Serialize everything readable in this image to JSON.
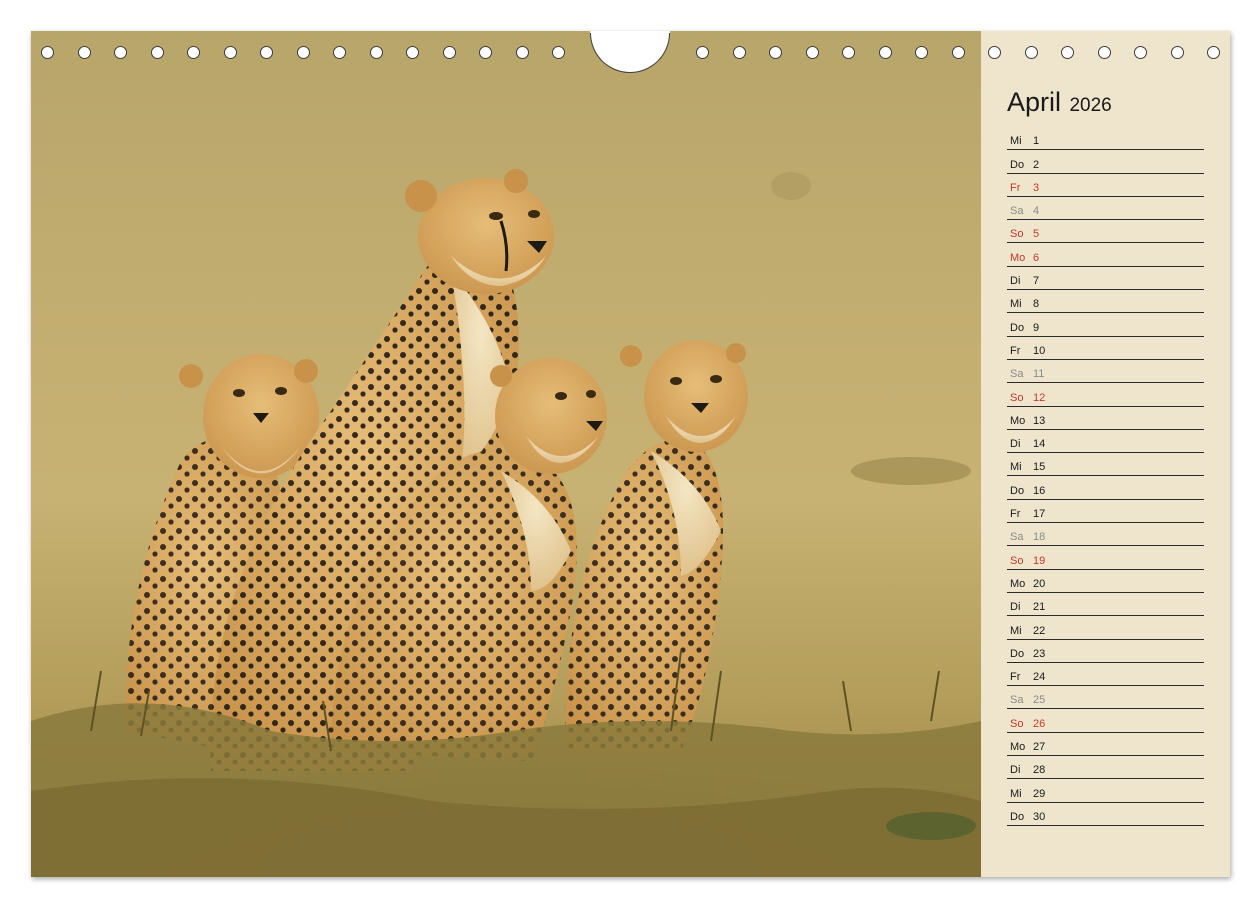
{
  "calendar": {
    "month": "April",
    "year": "2026",
    "days": [
      {
        "dw": "Mi",
        "dn": "1",
        "type": "normal"
      },
      {
        "dw": "Do",
        "dn": "2",
        "type": "normal"
      },
      {
        "dw": "Fr",
        "dn": "3",
        "type": "holiday"
      },
      {
        "dw": "Sa",
        "dn": "4",
        "type": "saturday"
      },
      {
        "dw": "So",
        "dn": "5",
        "type": "holiday"
      },
      {
        "dw": "Mo",
        "dn": "6",
        "type": "holiday"
      },
      {
        "dw": "Di",
        "dn": "7",
        "type": "normal"
      },
      {
        "dw": "Mi",
        "dn": "8",
        "type": "normal"
      },
      {
        "dw": "Do",
        "dn": "9",
        "type": "normal"
      },
      {
        "dw": "Fr",
        "dn": "10",
        "type": "normal"
      },
      {
        "dw": "Sa",
        "dn": "11",
        "type": "saturday"
      },
      {
        "dw": "So",
        "dn": "12",
        "type": "holiday"
      },
      {
        "dw": "Mo",
        "dn": "13",
        "type": "normal"
      },
      {
        "dw": "Di",
        "dn": "14",
        "type": "normal"
      },
      {
        "dw": "Mi",
        "dn": "15",
        "type": "normal"
      },
      {
        "dw": "Do",
        "dn": "16",
        "type": "normal"
      },
      {
        "dw": "Fr",
        "dn": "17",
        "type": "normal"
      },
      {
        "dw": "Sa",
        "dn": "18",
        "type": "saturday"
      },
      {
        "dw": "So",
        "dn": "19",
        "type": "holiday"
      },
      {
        "dw": "Mo",
        "dn": "20",
        "type": "normal"
      },
      {
        "dw": "Di",
        "dn": "21",
        "type": "normal"
      },
      {
        "dw": "Mi",
        "dn": "22",
        "type": "normal"
      },
      {
        "dw": "Do",
        "dn": "23",
        "type": "normal"
      },
      {
        "dw": "Fr",
        "dn": "24",
        "type": "normal"
      },
      {
        "dw": "Sa",
        "dn": "25",
        "type": "saturday"
      },
      {
        "dw": "So",
        "dn": "26",
        "type": "holiday"
      },
      {
        "dw": "Mo",
        "dn": "27",
        "type": "normal"
      },
      {
        "dw": "Di",
        "dn": "28",
        "type": "normal"
      },
      {
        "dw": "Mi",
        "dn": "29",
        "type": "normal"
      },
      {
        "dw": "Do",
        "dn": "30",
        "type": "normal"
      }
    ]
  },
  "photo": {
    "subject": "cheetah-family-photo",
    "colors": {
      "fur": "#d9a95e",
      "fur_light": "#ecd7a8",
      "spots": "#1e1a14",
      "grass": "#8c7a3e"
    }
  },
  "colors": {
    "paper": "#efe5cd",
    "holiday": "#c0392b",
    "saturday": "#8a8a8a",
    "text": "#1a1a1a"
  }
}
